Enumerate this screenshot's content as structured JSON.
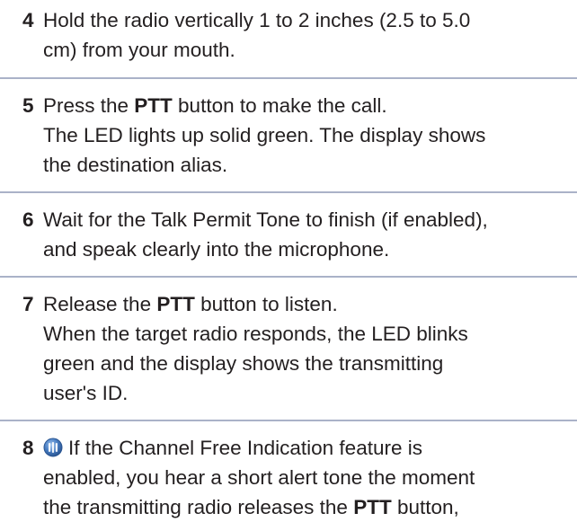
{
  "steps": [
    {
      "number": "4",
      "lines": [
        "Hold the radio vertically 1 to 2 inches (2.5 to 5.0",
        "cm) from your mouth."
      ]
    },
    {
      "number": "5",
      "line1_pre": "Press the ",
      "line1_bold": "PTT",
      "line1_post": " button to make the call.",
      "lines": [
        "The LED lights up solid green. The display shows",
        "the destination alias."
      ]
    },
    {
      "number": "6",
      "lines": [
        "Wait for the Talk Permit Tone to finish (if enabled),",
        "and speak clearly into the microphone."
      ]
    },
    {
      "number": "7",
      "line1_pre": "Release the ",
      "line1_bold": "PTT",
      "line1_post": " button to listen.",
      "lines": [
        "When the target radio responds, the LED blinks",
        "green and the display shows the transmitting",
        "user's ID."
      ]
    },
    {
      "number": "8",
      "icon": "feature-globe-icon",
      "line1": "If the Channel Free Indication feature is",
      "line2": "enabled, you hear a short alert tone the moment",
      "line3_pre": "the transmitting radio releases the ",
      "line3_bold": "PTT",
      "line3_post": " button,"
    }
  ],
  "colors": {
    "text": "#231f20",
    "separator": "#aab2c8",
    "icon_blue": "#3d6fb5"
  }
}
